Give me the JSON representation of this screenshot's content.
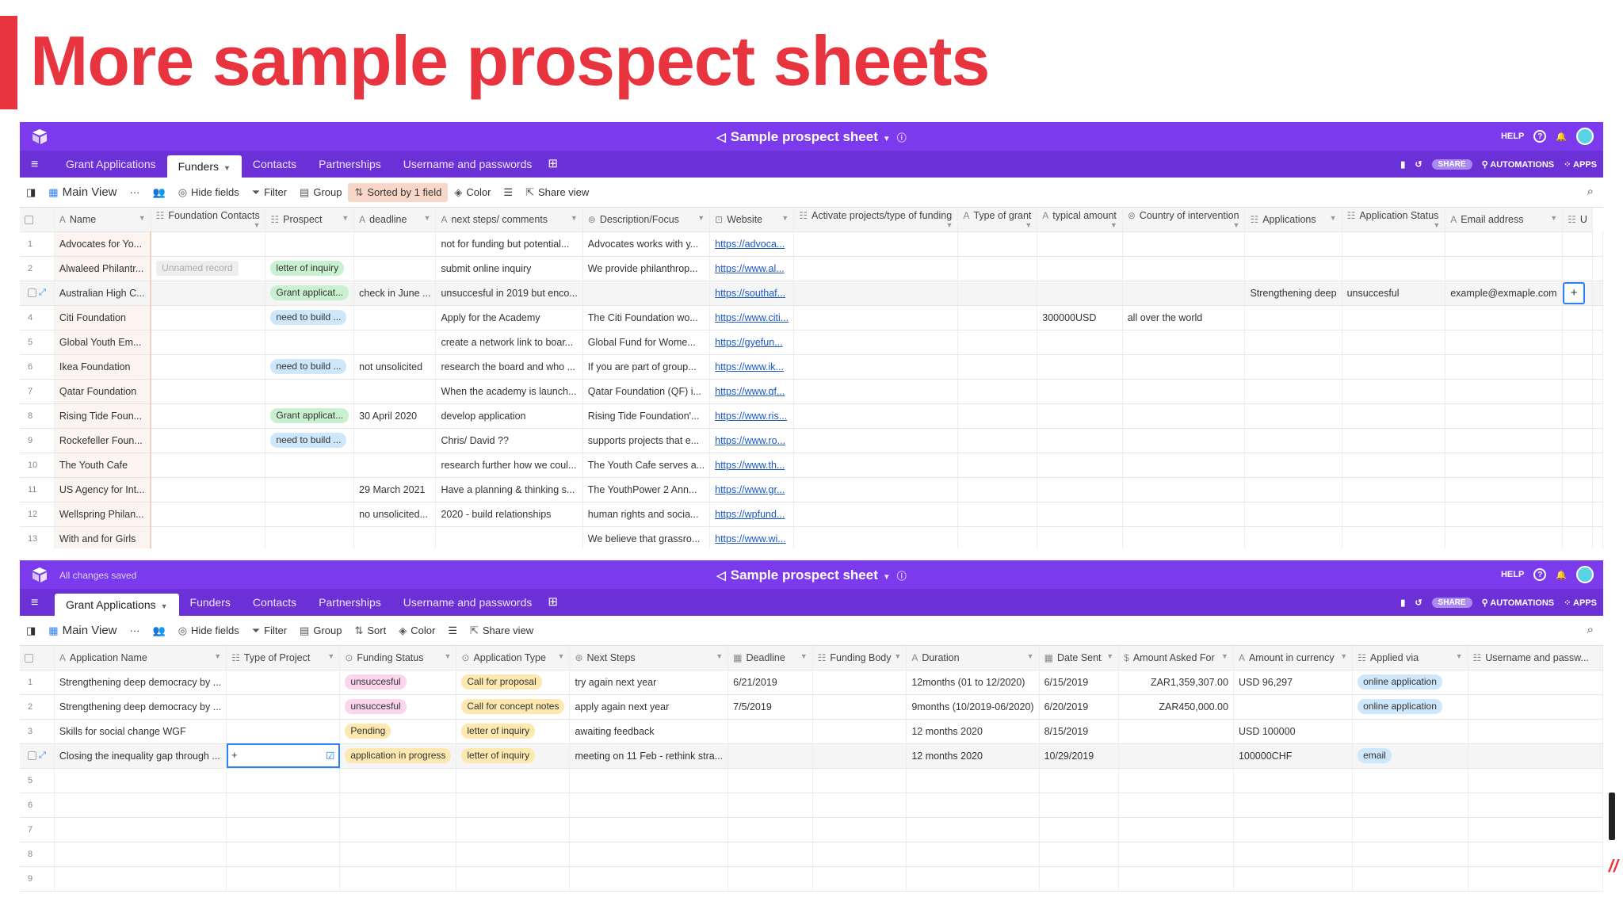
{
  "slide": {
    "title": "More sample prospect sheets"
  },
  "colors": {
    "accent": "#e8343f",
    "appbar": "#7c3aed",
    "tabbar": "#6c31d6"
  },
  "top": {
    "base_title": "Sample prospect sheet",
    "help": "HELP",
    "tabs": [
      "Grant Applications",
      "Funders",
      "Contacts",
      "Partnerships",
      "Username and passwords"
    ],
    "active_tab": "Funders",
    "share": "SHARE",
    "automations": "AUTOMATIONS",
    "apps": "APPS",
    "toolbar": {
      "view": "Main View",
      "hide": "Hide fields",
      "filter": "Filter",
      "group": "Group",
      "sort": "Sorted by 1 field",
      "color": "Color",
      "share_view": "Share view"
    },
    "columns": [
      "Name",
      "Foundation Contacts",
      "Prospect",
      "deadline",
      "next steps/ comments",
      "Description/Focus",
      "Website",
      "Activate projects/type of funding",
      "Type of grant",
      "typical amount",
      "Country of intervention",
      "Applications",
      "Application Status",
      "Email address",
      "U"
    ],
    "rows": [
      {
        "n": "1",
        "name": "Advocates for Yo...",
        "contacts": "",
        "prospect": "",
        "deadline": "",
        "next": "not for funding but potential...",
        "desc": "Advocates works with y...",
        "web": "https://advoca...",
        "amount": "",
        "country": "",
        "apps": "",
        "status": "",
        "email": ""
      },
      {
        "n": "2",
        "name": "Alwaleed Philantr...",
        "contacts": "Unnamed record",
        "prospect": "letter of inquiry",
        "deadline": "",
        "next": "submit online inquiry",
        "desc": "We provide philanthrop...",
        "web": "https://www.al...",
        "amount": "",
        "country": "",
        "apps": "",
        "status": "",
        "email": ""
      },
      {
        "n": "",
        "name": "Australian High C...",
        "contacts": "",
        "prospect": "Grant applicat...",
        "deadline": "check in June ...",
        "next": "unsuccesful in 2019 but enco...",
        "desc": "",
        "web": "https://southaf...",
        "amount": "",
        "country": "",
        "apps": "Strengthening deep",
        "status": "unsuccesful",
        "email": "example@exmaple.com"
      },
      {
        "n": "4",
        "name": "Citi Foundation",
        "contacts": "",
        "prospect": "need to build ...",
        "deadline": "",
        "next": "Apply for the Academy",
        "desc": "The Citi Foundation wo...",
        "web": "https://www.citi...",
        "amount": "300000USD",
        "country": "all over the world",
        "apps": "",
        "status": "",
        "email": ""
      },
      {
        "n": "5",
        "name": "Global Youth Em...",
        "contacts": "",
        "prospect": "",
        "deadline": "",
        "next": "create a network link to boar...",
        "desc": "Global Fund for Wome...",
        "web": "https://gyefun...",
        "amount": "",
        "country": "",
        "apps": "",
        "status": "",
        "email": ""
      },
      {
        "n": "6",
        "name": "Ikea Foundation",
        "contacts": "",
        "prospect": "need to build ...",
        "deadline": "not unsolicited",
        "next": "research the board and who ...",
        "desc": "If you are part of group...",
        "web": "https://www.ik...",
        "amount": "",
        "country": "",
        "apps": "",
        "status": "",
        "email": ""
      },
      {
        "n": "7",
        "name": "Qatar Foundation",
        "contacts": "",
        "prospect": "",
        "deadline": "",
        "next": "When the academy is launch...",
        "desc": "Qatar Foundation (QF) i...",
        "web": "https://www.qf...",
        "amount": "",
        "country": "",
        "apps": "",
        "status": "",
        "email": ""
      },
      {
        "n": "8",
        "name": "Rising Tide Foun...",
        "contacts": "",
        "prospect": "Grant applicat...",
        "deadline": "30 April 2020",
        "next": "develop application",
        "desc": "Rising Tide Foundation'...",
        "web": "https://www.ris...",
        "amount": "",
        "country": "",
        "apps": "",
        "status": "",
        "email": ""
      },
      {
        "n": "9",
        "name": "Rockefeller Foun...",
        "contacts": "",
        "prospect": "need to build ...",
        "deadline": "",
        "next": "Chris/ David ??",
        "desc": "supports projects that e...",
        "web": "https://www.ro...",
        "amount": "",
        "country": "",
        "apps": "",
        "status": "",
        "email": ""
      },
      {
        "n": "10",
        "name": "The Youth Cafe",
        "contacts": "",
        "prospect": "",
        "deadline": "",
        "next": "research further how we coul...",
        "desc": "The Youth Cafe serves a...",
        "web": "https://www.th...",
        "amount": "",
        "country": "",
        "apps": "",
        "status": "",
        "email": ""
      },
      {
        "n": "11",
        "name": "US Agency for Int...",
        "contacts": "",
        "prospect": "",
        "deadline": "29 March 2021",
        "next": "Have a planning & thinking s...",
        "desc": "The YouthPower 2 Ann...",
        "web": "https://www.gr...",
        "amount": "",
        "country": "",
        "apps": "",
        "status": "",
        "email": ""
      },
      {
        "n": "12",
        "name": "Wellspring Philan...",
        "contacts": "",
        "prospect": "",
        "deadline": "no unsolicited...",
        "next": "2020 - build relationships",
        "desc": "human rights and socia...",
        "web": "https://wpfund...",
        "amount": "",
        "country": "",
        "apps": "",
        "status": "",
        "email": ""
      },
      {
        "n": "13",
        "name": "With and for Girls",
        "contacts": "",
        "prospect": "",
        "deadline": "",
        "next": "",
        "desc": "We believe that grassro...",
        "web": "https://www.wi...",
        "amount": "",
        "country": "",
        "apps": "",
        "status": "",
        "email": ""
      }
    ]
  },
  "bottom": {
    "saved": "All changes saved",
    "base_title": "Sample prospect sheet",
    "help": "HELP",
    "tabs": [
      "Grant Applications",
      "Funders",
      "Contacts",
      "Partnerships",
      "Username and passwords"
    ],
    "active_tab": "Grant Applications",
    "share": "SHARE",
    "automations": "AUTOMATIONS",
    "apps": "APPS",
    "toolbar": {
      "view": "Main View",
      "hide": "Hide fields",
      "filter": "Filter",
      "group": "Group",
      "sort": "Sort",
      "color": "Color",
      "share_view": "Share view"
    },
    "columns": [
      "Application Name",
      "Type of Project",
      "Funding Status",
      "Application Type",
      "Next Steps",
      "Deadline",
      "Funding Body",
      "Duration",
      "Date Sent",
      "Amount Asked For",
      "Amount in currency",
      "Applied via",
      "Username and passw..."
    ],
    "rows": [
      {
        "n": "1",
        "name": "Strengthening deep democracy by ...",
        "status": "unsuccesful",
        "status_c": "pink",
        "type": "Call for proposal",
        "next": "try again next year",
        "deadline": "6/21/2019",
        "duration": "12months (01 to 12/2020)",
        "sent": "6/15/2019",
        "asked": "ZAR1,359,307.00",
        "currency": "USD 96,297",
        "via": "online application"
      },
      {
        "n": "2",
        "name": "Strengthening deep democracy by ...",
        "status": "unsuccesful",
        "status_c": "pink",
        "type": "Call for concept notes",
        "next": "apply again next year",
        "deadline": "7/5/2019",
        "duration": "9months (10/2019-06/2020)",
        "sent": "6/20/2019",
        "asked": "ZAR450,000.00",
        "currency": "",
        "via": "online application"
      },
      {
        "n": "3",
        "name": "Skills for social change WGF",
        "status": "Pending",
        "status_c": "yellow",
        "type": "letter of inquiry",
        "next": "awaiting feedback",
        "deadline": "",
        "duration": "12 months 2020",
        "sent": "8/15/2019",
        "asked": "",
        "currency": "USD 100000",
        "via": ""
      },
      {
        "n": "",
        "name": "Closing the inequality gap through ...",
        "status": "application in progress",
        "status_c": "yellow",
        "type": "letter of inquiry",
        "next": "meeting on 11 Feb - rethink stra...",
        "deadline": "",
        "duration": "12 months 2020",
        "sent": "10/29/2019",
        "asked": "",
        "currency": "100000CHF",
        "via": "email"
      }
    ],
    "empty_rows": [
      "5",
      "6",
      "7",
      "8",
      "9"
    ]
  }
}
